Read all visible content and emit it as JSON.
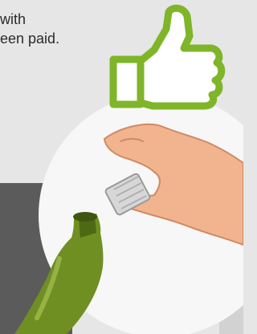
{
  "caption": {
    "line1": "with",
    "line2": "een paid."
  },
  "icons": {
    "thumb": "thumbs-up-icon",
    "hand": "hand-icon",
    "cap": "bottle-cap-icon",
    "bottle": "bottle-icon"
  },
  "colors": {
    "background": "#e6e6e6",
    "circle": "#f7f7f7",
    "thumb_outline": "#7fb528",
    "skin": "#f2b48e",
    "bottle_green": "#6f8f22"
  }
}
